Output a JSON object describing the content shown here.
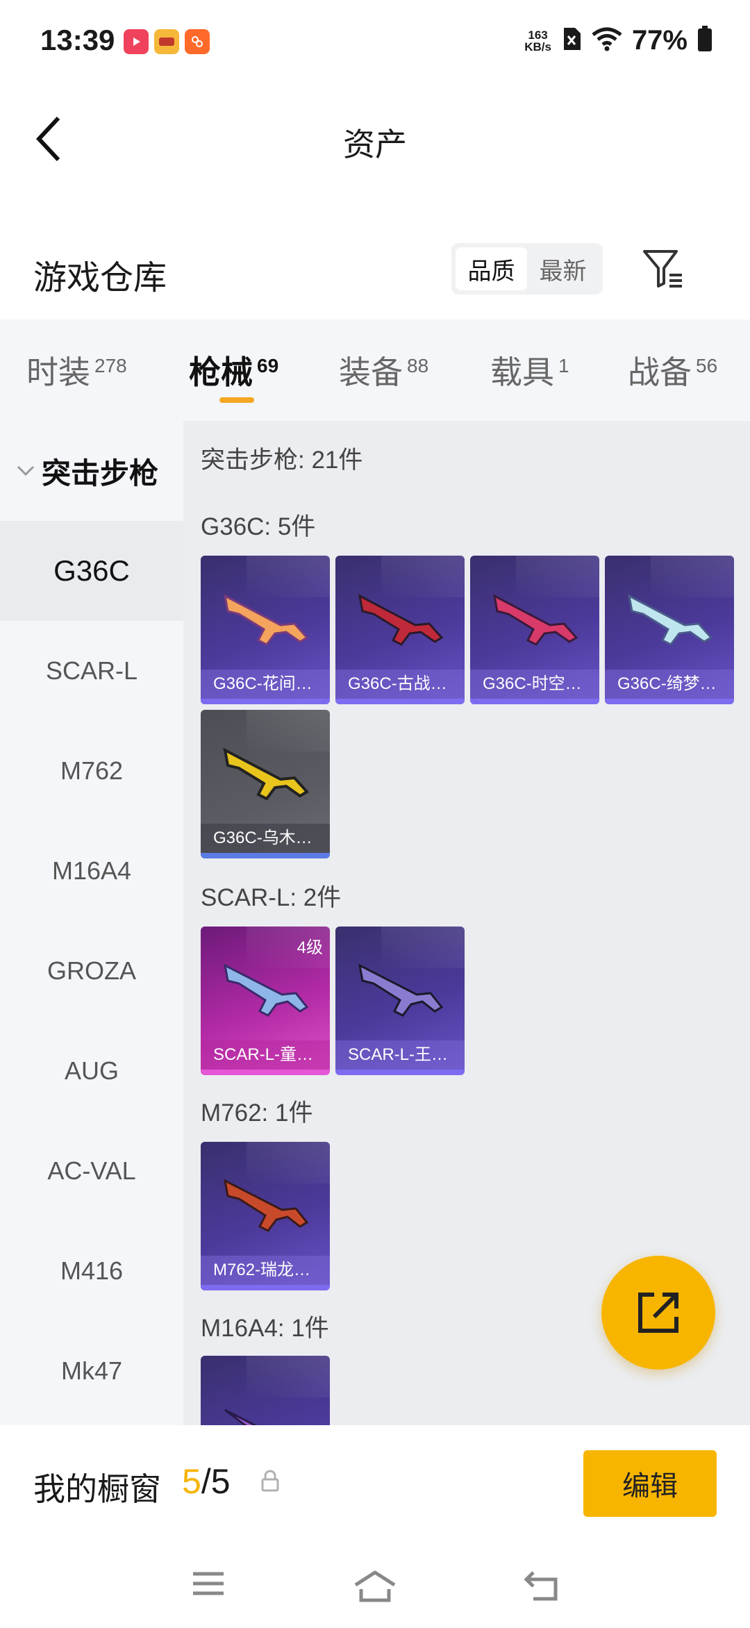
{
  "status_bar": {
    "time": "13:39",
    "net_speed_value": "163",
    "net_speed_unit": "KB/s",
    "battery": "77%"
  },
  "header": {
    "title": "资产"
  },
  "warehouse": {
    "title": "游戏仓库",
    "sort_options": [
      "品质",
      "最新"
    ],
    "sort_active": "品质"
  },
  "tabs": [
    {
      "label": "时装",
      "count": "278"
    },
    {
      "label": "枪械",
      "count": "69",
      "active": true
    },
    {
      "label": "装备",
      "count": "88"
    },
    {
      "label": "载具",
      "count": "1"
    },
    {
      "label": "战备",
      "count": "56"
    }
  ],
  "left_nav": {
    "group": "突击步枪",
    "items": [
      "G36C",
      "SCAR-L",
      "M762",
      "M16A4",
      "GROZA",
      "AUG",
      "AC-VAL",
      "M416",
      "Mk47"
    ],
    "active": "G36C"
  },
  "content": {
    "group_header": "突击步枪: 21件",
    "sections": [
      {
        "title": "G36C: 5件",
        "items": [
          {
            "label": "G36C-花间…",
            "style": "purple"
          },
          {
            "label": "G36C-古战…",
            "style": "purple"
          },
          {
            "label": "G36C-时空…",
            "style": "purple"
          },
          {
            "label": "G36C-绮梦…",
            "style": "purple"
          },
          {
            "label": "G36C-乌木…",
            "style": "gray"
          }
        ]
      },
      {
        "title": "SCAR-L: 2件",
        "items": [
          {
            "label": "SCAR-L-童…",
            "style": "pink",
            "level": "4级"
          },
          {
            "label": "SCAR-L-王…",
            "style": "purple"
          }
        ]
      },
      {
        "title": "M762: 1件",
        "items": [
          {
            "label": "M762-瑞龙…",
            "style": "purple"
          }
        ]
      },
      {
        "title": "M16A4: 1件",
        "items": []
      }
    ]
  },
  "showcase": {
    "title": "我的橱窗",
    "current": "5",
    "total": "/5",
    "edit_label": "编辑"
  },
  "colors": {
    "accent": "#f7b500",
    "tab_indicator": "#f5a623"
  }
}
